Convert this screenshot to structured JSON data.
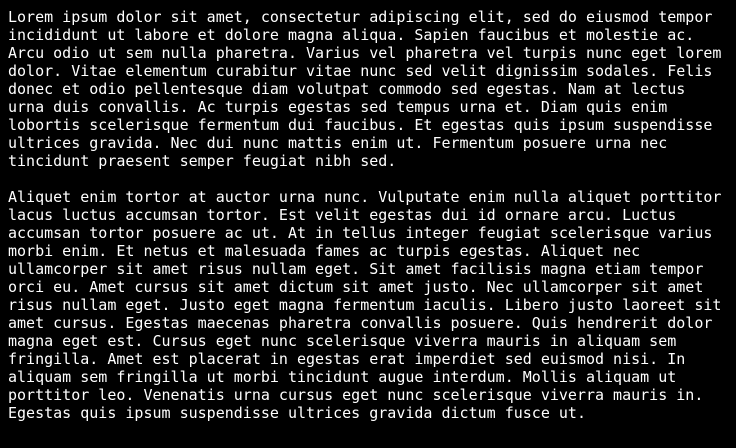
{
  "terminal": {
    "lines": [
      "Lorem ipsum dolor sit amet, consectetur adipiscing elit, sed do eiusmod tempor",
      "incididunt ut labore et dolore magna aliqua. Sapien faucibus et molestie ac.",
      "Arcu odio ut sem nulla pharetra. Varius vel pharetra vel turpis nunc eget lorem",
      "dolor. Vitae elementum curabitur vitae nunc sed velit dignissim sodales. Felis",
      "donec et odio pellentesque diam volutpat commodo sed egestas. Nam at lectus",
      "urna duis convallis. Ac turpis egestas sed tempus urna et. Diam quis enim",
      "lobortis scelerisque fermentum dui faucibus. Et egestas quis ipsum suspendisse",
      "ultrices gravida. Nec dui nunc mattis enim ut. Fermentum posuere urna nec",
      "tincidunt praesent semper feugiat nibh sed.",
      "",
      "Aliquet enim tortor at auctor urna nunc. Vulputate enim nulla aliquet porttitor",
      "lacus luctus accumsan tortor. Est velit egestas dui id ornare arcu. Luctus",
      "accumsan tortor posuere ac ut. At in tellus integer feugiat scelerisque varius",
      "morbi enim. Et netus et malesuada fames ac turpis egestas. Aliquet nec",
      "ullamcorper sit amet risus nullam eget. Sit amet facilisis magna etiam tempor",
      "orci eu. Amet cursus sit amet dictum sit amet justo. Nec ullamcorper sit amet",
      "risus nullam eget. Justo eget magna fermentum iaculis. Libero justo laoreet sit",
      "amet cursus. Egestas maecenas pharetra convallis posuere. Quis hendrerit dolor",
      "magna eget est. Cursus eget nunc scelerisque viverra mauris in aliquam sem",
      "fringilla. Amet est placerat in egestas erat imperdiet sed euismod nisi. In",
      "aliquam sem fringilla ut morbi tincidunt augue interdum. Mollis aliquam ut",
      "porttitor leo. Venenatis urna cursus eget nunc scelerisque viverra mauris in.",
      "Egestas quis ipsum suspendisse ultrices gravida dictum fusce ut."
    ]
  },
  "colors": {
    "background": "#000000",
    "text": "#ffffff"
  }
}
